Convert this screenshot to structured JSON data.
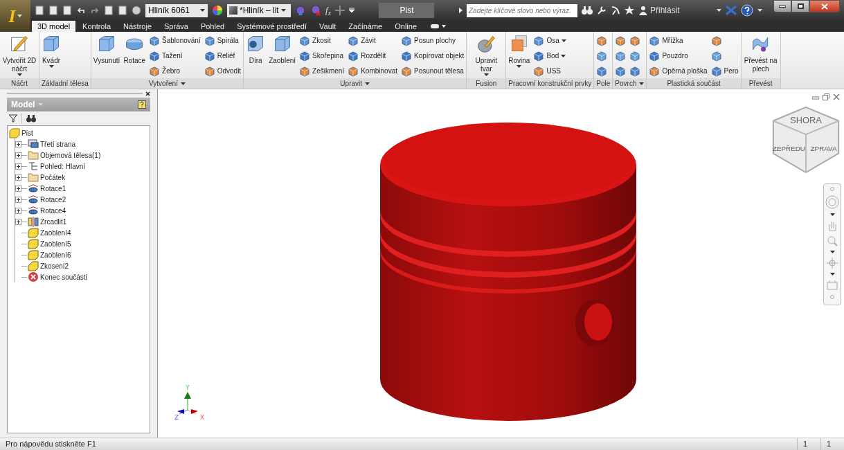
{
  "app_button": {
    "label": "I"
  },
  "quick_access": {
    "material": "Hliník 6061",
    "appearance": "*Hliník – lit",
    "formula": "f$_{x}$"
  },
  "title_bar": {
    "document": "Pist",
    "search_placeholder": "Zadejte klíčové slovo nebo výraz.",
    "sign_in": "Přihlásit"
  },
  "tabs": [
    {
      "label": "3D model",
      "selected": true
    },
    {
      "label": "Kontrola",
      "selected": false
    },
    {
      "label": "Nástroje",
      "selected": false
    },
    {
      "label": "Správa",
      "selected": false
    },
    {
      "label": "Pohled",
      "selected": false
    },
    {
      "label": "Systémové prostředí",
      "selected": false
    },
    {
      "label": "Vault",
      "selected": false
    },
    {
      "label": "Začínáme",
      "selected": false
    },
    {
      "label": "Online",
      "selected": false
    }
  ],
  "ribbon": {
    "panels": [
      {
        "title": "Náčrt",
        "menu": false,
        "groups": [
          {
            "kind": "large",
            "label": "Vytvořit 2D náčrt",
            "dropdown": true
          }
        ]
      },
      {
        "title": "Základní tělesa",
        "menu": false,
        "groups": [
          {
            "kind": "large",
            "label": "Kvádr",
            "dropdown": true
          }
        ]
      },
      {
        "title": "Vytvoření",
        "menu": true,
        "groups": [
          {
            "kind": "large",
            "label": "Vysunutí",
            "dropdown": false
          },
          {
            "kind": "large",
            "label": "Rotace",
            "dropdown": false
          },
          {
            "kind": "stack",
            "items": [
              {
                "label": "Šablonování",
                "dropdown": false
              },
              {
                "label": "Tažení",
                "dropdown": false
              },
              {
                "label": "Žebro",
                "dropdown": false
              }
            ]
          },
          {
            "kind": "stack",
            "items": [
              {
                "label": "Spirála",
                "dropdown": false
              },
              {
                "label": "Reliéf",
                "dropdown": false
              },
              {
                "label": "Odvodit",
                "dropdown": false
              }
            ]
          }
        ]
      },
      {
        "title": "Upravit",
        "menu": true,
        "groups": [
          {
            "kind": "large",
            "label": "Díra",
            "dropdown": false
          },
          {
            "kind": "large",
            "label": "Zaoblení",
            "dropdown": false
          },
          {
            "kind": "stack",
            "items": [
              {
                "label": "Zkosit",
                "dropdown": false
              },
              {
                "label": "Skořepina",
                "dropdown": false
              },
              {
                "label": "Zešikmení",
                "dropdown": false
              }
            ]
          },
          {
            "kind": "stack",
            "items": [
              {
                "label": "Závit",
                "dropdown": false
              },
              {
                "label": "Rozdělit",
                "dropdown": false
              },
              {
                "label": "Kombinovat",
                "dropdown": false
              }
            ]
          },
          {
            "kind": "stack",
            "items": [
              {
                "label": "Posun plochy",
                "dropdown": false
              },
              {
                "label": "Kopírovat objekt",
                "dropdown": false
              },
              {
                "label": "Posunout tělesa",
                "dropdown": false
              }
            ]
          }
        ]
      },
      {
        "title": "Fusion",
        "menu": false,
        "groups": [
          {
            "kind": "large",
            "label": "Upravit tvar",
            "dropdown": true
          }
        ]
      },
      {
        "title": "Pracovní konstrukční prvky",
        "menu": false,
        "groups": [
          {
            "kind": "large",
            "label": "Rovina",
            "dropdown": true
          },
          {
            "kind": "stack",
            "items": [
              {
                "label": "Osa",
                "dropdown": true
              },
              {
                "label": "Bod",
                "dropdown": true
              },
              {
                "label": "USS",
                "dropdown": false
              }
            ]
          }
        ]
      },
      {
        "title": "Pole",
        "menu": false,
        "groups": [
          {
            "kind": "icons"
          }
        ]
      },
      {
        "title": "Povrch",
        "menu": true,
        "groups": [
          {
            "kind": "icons"
          },
          {
            "kind": "icons"
          }
        ]
      },
      {
        "title": "Plastická součást",
        "menu": false,
        "groups": [
          {
            "kind": "stack",
            "items": [
              {
                "label": "Mřížka",
                "dropdown": false
              },
              {
                "label": "Pouzdro",
                "dropdown": false
              },
              {
                "label": "Opěrná ploška",
                "dropdown": false
              }
            ]
          },
          {
            "kind": "icons",
            "last_label": "Pero"
          }
        ]
      },
      {
        "title": "Převést",
        "menu": false,
        "groups": [
          {
            "kind": "large",
            "label": "Převést na plech",
            "dropdown": false
          }
        ]
      }
    ]
  },
  "browser": {
    "title": "Model",
    "tree": [
      {
        "label": "Pist",
        "kind": "part",
        "children": [
          {
            "label": "Třetí strana",
            "kind": "view",
            "expandable": true
          },
          {
            "label": "Objemová tělesa(1)",
            "kind": "folder",
            "expandable": true
          },
          {
            "label": "Pohled: Hlavní",
            "kind": "rep",
            "expandable": true
          },
          {
            "label": "Počátek",
            "kind": "folder",
            "expandable": true
          },
          {
            "label": "Rotace1",
            "kind": "revolve",
            "expandable": true
          },
          {
            "label": "Rotace2",
            "kind": "revolve",
            "expandable": true
          },
          {
            "label": "Rotace4",
            "kind": "revolve",
            "expandable": true
          },
          {
            "label": "Zrcadlit1",
            "kind": "mirror",
            "expandable": true
          },
          {
            "label": "Zaoblení4",
            "kind": "fillet",
            "expandable": false
          },
          {
            "label": "Zaoblení5",
            "kind": "fillet",
            "expandable": false
          },
          {
            "label": "Zaoblení6",
            "kind": "fillet",
            "expandable": false
          },
          {
            "label": "Zkosení2",
            "kind": "chamfer",
            "expandable": false
          },
          {
            "label": "Konec součásti",
            "kind": "end",
            "expandable": false
          }
        ]
      }
    ]
  },
  "viewport": {
    "view_cube": {
      "top": "SHORA",
      "front": "ZEPŘEDU",
      "right": "ZPRAVA"
    },
    "axes": {
      "x": "X",
      "y": "Y",
      "z": "Z"
    }
  },
  "status_bar": {
    "message": "Pro nápovědu stiskněte F1",
    "fields": [
      "1",
      "1"
    ]
  }
}
